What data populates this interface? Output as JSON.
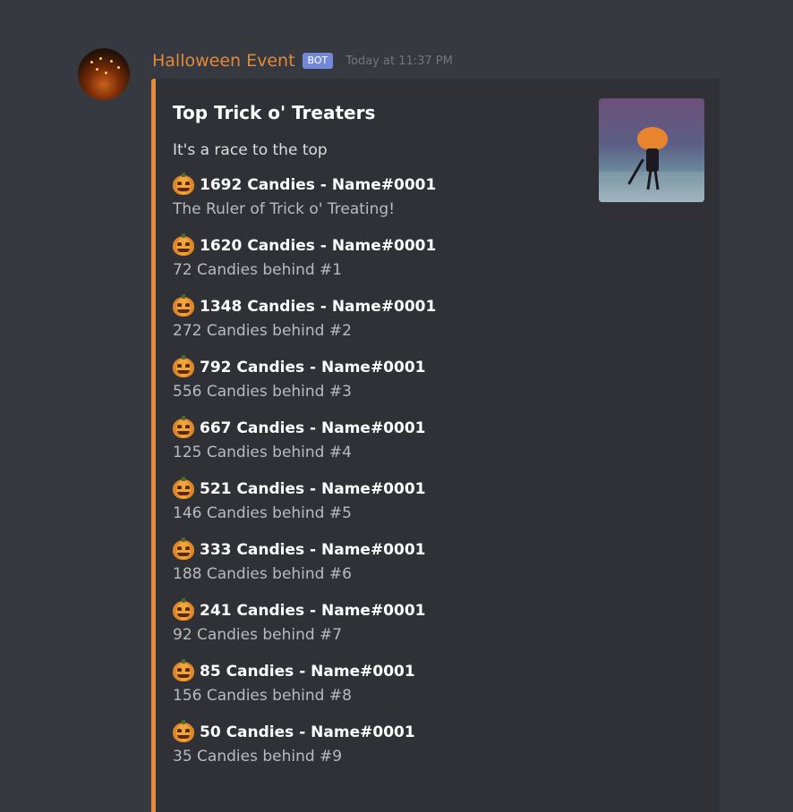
{
  "message": {
    "username": "Halloween Event",
    "bot_tag": "BOT",
    "timestamp": "Today at 11:37 PM"
  },
  "embed": {
    "accent_color": "#e3893c",
    "title": "Top Trick o' Treaters",
    "description": "It's a race to the top",
    "entries": [
      {
        "candies": "1692 Candies - ",
        "name": "Name#0001",
        "note": "The Ruler of Trick o' Treating!"
      },
      {
        "candies": "1620 Candies - ",
        "name": "Name#0001",
        "note": "72 Candies behind #1"
      },
      {
        "candies": "1348 Candies - ",
        "name": "Name#0001",
        "note": "272 Candies behind #2"
      },
      {
        "candies": "792 Candies - ",
        "name": "Name#0001",
        "note": "556 Candies behind #3"
      },
      {
        "candies": "667 Candies - ",
        "name": "Name#0001",
        "note": "125 Candies behind #4"
      },
      {
        "candies": "521 Candies - ",
        "name": "Name#0001",
        "note": "146 Candies behind #5"
      },
      {
        "candies": "333 Candies - ",
        "name": "Name#0001",
        "note": "188 Candies behind #6"
      },
      {
        "candies": "241 Candies - ",
        "name": "Name#0001",
        "note": "92 Candies behind #7"
      },
      {
        "candies": "85 Candies - ",
        "name": "Name#0001",
        "note": "156 Candies behind #8"
      },
      {
        "candies": "50 Candies - ",
        "name": "Name#0001",
        "note": "35 Candies behind #9"
      }
    ],
    "entry_icon": "jack-o-lantern-icon"
  }
}
